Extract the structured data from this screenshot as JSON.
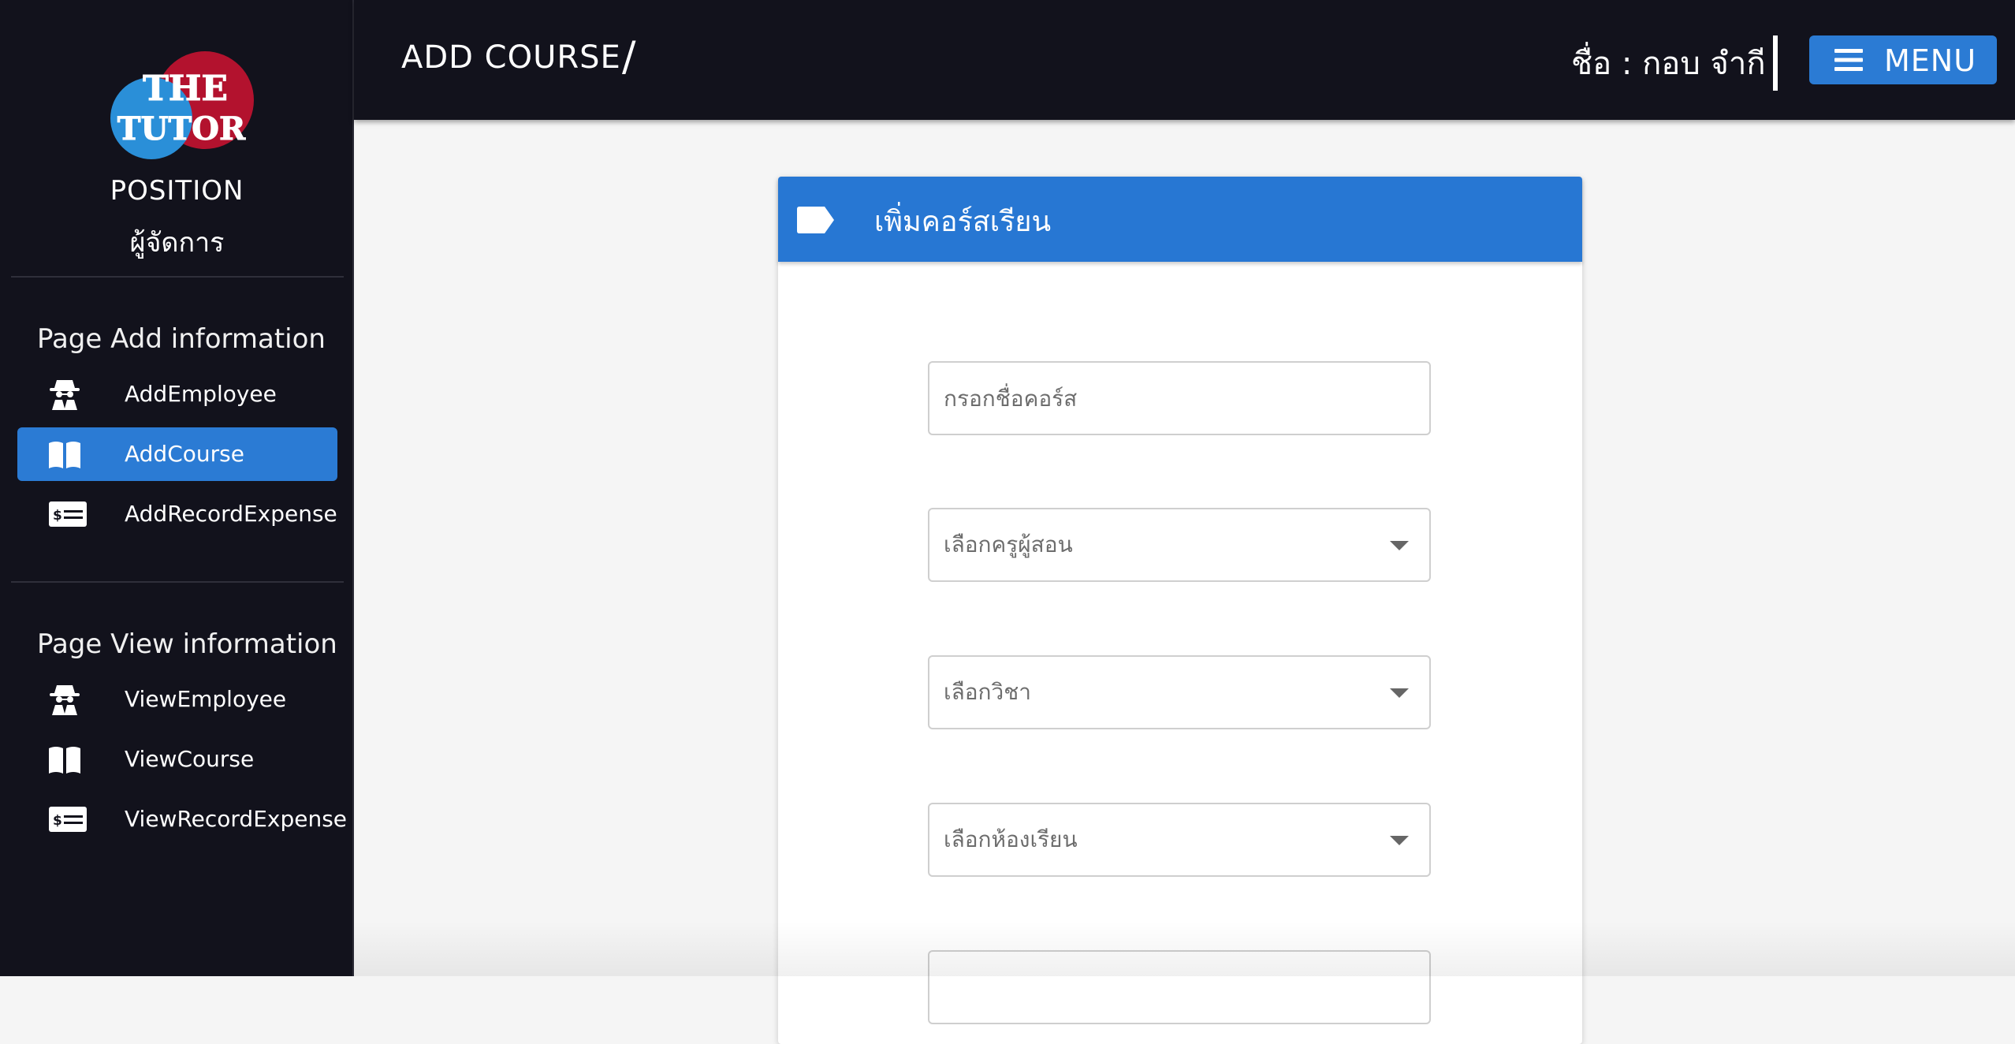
{
  "header": {
    "page_title": "ADD COURSE",
    "breadcrumb_separator": "/",
    "user_name": "ชื่อ : กอบ จำกี",
    "menu_label": "MENU"
  },
  "sidebar": {
    "logo_text": [
      "THE",
      "TUTOR"
    ],
    "position_label": "POSITION",
    "position_value": "ผู้จัดการ",
    "sections": [
      {
        "title": "Page Add information",
        "items": [
          {
            "label": "AddEmployee",
            "icon": "spy-icon"
          },
          {
            "label": "AddCourse",
            "icon": "book-icon",
            "active": true
          },
          {
            "label": "AddRecordExpense",
            "icon": "money-check-icon"
          }
        ]
      },
      {
        "title": "Page View information",
        "items": [
          {
            "label": "ViewEmployee",
            "icon": "spy-icon"
          },
          {
            "label": "ViewCourse",
            "icon": "book-icon"
          },
          {
            "label": "ViewRecordExpense",
            "icon": "money-check-icon"
          }
        ]
      }
    ]
  },
  "form": {
    "title": "เพิ่มคอร์สเรียน",
    "course_name_placeholder": "กรอกชื่อคอร์ส",
    "teacher_select": "เลือกครูผู้สอน",
    "subject_select": "เลือกวิชา",
    "room_select": "เลือกห้องเรียน"
  },
  "colors": {
    "sidebar_bg": "#12121c",
    "accent": "#2b7bd4",
    "logo_blue": "#2a8fd8",
    "logo_red": "#b3122e"
  }
}
